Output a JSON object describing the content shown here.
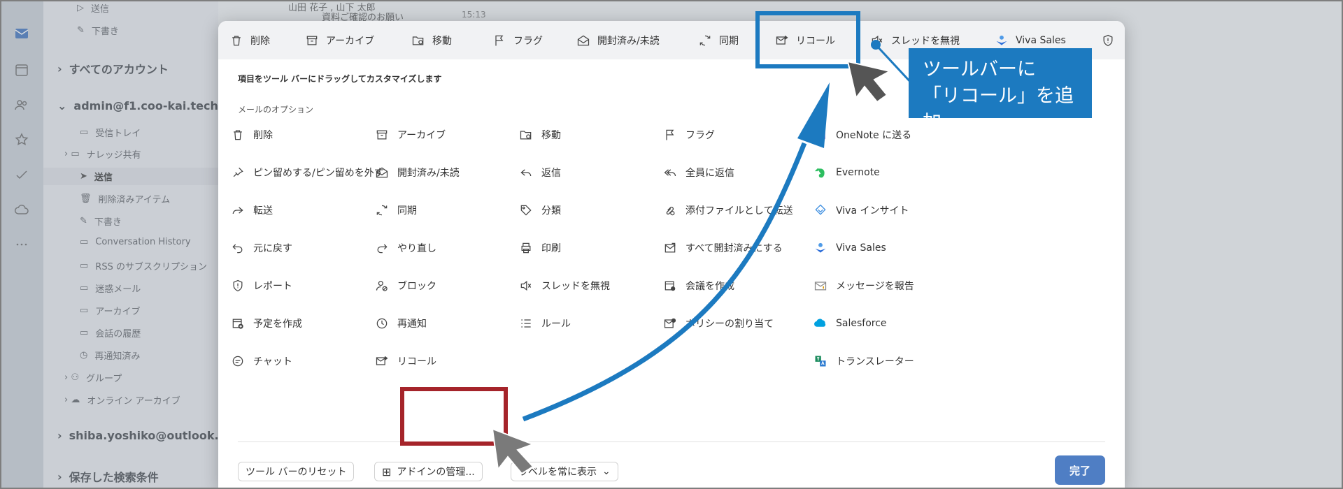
{
  "sidebar": {
    "items": [
      {
        "label": "送信"
      },
      {
        "label": "下書き"
      },
      {
        "label": "すべてのアカウント"
      },
      {
        "label": "admin@f1.coo-kai.tech"
      },
      {
        "label": "受信トレイ"
      },
      {
        "label": "ナレッジ共有"
      },
      {
        "label": "送信"
      },
      {
        "label": "削除済みアイテム"
      },
      {
        "label": "下書き"
      },
      {
        "label": "Conversation History"
      },
      {
        "label": "RSS のサブスクリプション"
      },
      {
        "label": "迷惑メール"
      },
      {
        "label": "アーカイブ"
      },
      {
        "label": "会話の履歴"
      },
      {
        "label": "再通知済み"
      },
      {
        "label": "グループ"
      },
      {
        "label": "オンライン アーカイブ"
      },
      {
        "label": "shiba.yoshiko@outlook.jp"
      },
      {
        "label": "保存した検索条件"
      }
    ]
  },
  "message_peek": {
    "sender": "山田 花子 , 山下 太郎",
    "subject": "資料ご確認のお願い",
    "time": "15:13"
  },
  "toolbar": {
    "items": [
      {
        "label": "削除",
        "icon": "trash-icon"
      },
      {
        "label": "アーカイブ",
        "icon": "archive-icon"
      },
      {
        "label": "移動",
        "icon": "folder-move-icon"
      },
      {
        "label": "フラグ",
        "icon": "flag-icon"
      },
      {
        "label": "開封済み/未読",
        "icon": "envelope-open-icon"
      },
      {
        "label": "同期",
        "icon": "sync-icon"
      },
      {
        "label": "リコール",
        "icon": "recall-icon"
      },
      {
        "label": "スレッドを無視",
        "icon": "mute-icon"
      },
      {
        "label": "Viva Sales",
        "icon": "viva-sales-icon"
      }
    ]
  },
  "dialog": {
    "hint": "項目をツール バーにドラッグしてカスタマイズします",
    "section_title": "メールのオプション",
    "options": [
      {
        "label": "削除",
        "icon": "trash-icon"
      },
      {
        "label": "アーカイブ",
        "icon": "archive-icon"
      },
      {
        "label": "移動",
        "icon": "folder-move-icon"
      },
      {
        "label": "フラグ",
        "icon": "flag-icon"
      },
      {
        "label": "OneNote に送る",
        "icon": "onenote-icon"
      },
      {
        "label": "ピン留めする/ピン留めを外す",
        "icon": "pin-icon"
      },
      {
        "label": "開封済み/未読",
        "icon": "envelope-open-icon"
      },
      {
        "label": "返信",
        "icon": "reply-icon"
      },
      {
        "label": "全員に返信",
        "icon": "reply-all-icon"
      },
      {
        "label": "Evernote",
        "icon": "evernote-icon"
      },
      {
        "label": "転送",
        "icon": "forward-icon"
      },
      {
        "label": "同期",
        "icon": "sync-icon"
      },
      {
        "label": "分類",
        "icon": "tag-icon"
      },
      {
        "label": "添付ファイルとして転送",
        "icon": "attachment-forward-icon"
      },
      {
        "label": "Viva インサイト",
        "icon": "viva-insights-icon"
      },
      {
        "label": "元に戻す",
        "icon": "undo-icon"
      },
      {
        "label": "やり直し",
        "icon": "redo-icon"
      },
      {
        "label": "印刷",
        "icon": "print-icon"
      },
      {
        "label": "すべて開封済みにする",
        "icon": "mark-all-read-icon"
      },
      {
        "label": "Viva Sales",
        "icon": "viva-sales-icon"
      },
      {
        "label": "レポート",
        "icon": "shield-icon"
      },
      {
        "label": "ブロック",
        "icon": "block-user-icon"
      },
      {
        "label": "スレッドを無視",
        "icon": "mute-icon"
      },
      {
        "label": "会議を作成",
        "icon": "meeting-icon"
      },
      {
        "label": "メッセージを報告",
        "icon": "report-message-icon"
      },
      {
        "label": "予定を作成",
        "icon": "calendar-add-icon"
      },
      {
        "label": "再通知",
        "icon": "clock-icon"
      },
      {
        "label": "ルール",
        "icon": "rules-icon"
      },
      {
        "label": "ポリシーの割り当て",
        "icon": "policy-icon"
      },
      {
        "label": "Salesforce",
        "icon": "salesforce-icon"
      },
      {
        "label": "チャット",
        "icon": "chat-icon"
      },
      {
        "label": "リコール",
        "icon": "recall-icon"
      },
      {
        "label": "トランスレーター",
        "icon": "translator-icon"
      }
    ]
  },
  "footer": {
    "reset_label": "ツール バーのリセット",
    "addins_label": "アドインの管理...",
    "labels_label": "ラベルを常に表示",
    "done_label": "完了"
  },
  "annotation": {
    "callout_line1": "ツールバーに",
    "callout_line2": "「リコール」を追加",
    "callout_color": "#1c7ac0",
    "source_highlight_color": "#a5242a"
  }
}
